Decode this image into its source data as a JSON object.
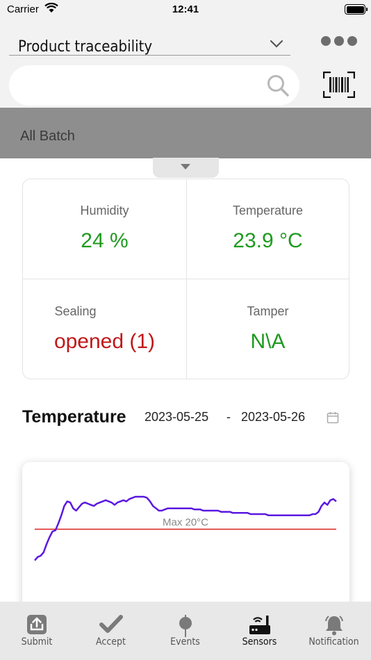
{
  "status_bar": {
    "carrier": "Carrier",
    "time": "12:41"
  },
  "header": {
    "dropdown_label": "Product traceability",
    "search_placeholder": ""
  },
  "filter": {
    "label": "All Batch"
  },
  "sensors": {
    "humidity": {
      "label": "Humidity",
      "value": "24 %"
    },
    "temperature": {
      "label": "Temperature",
      "value": "23.9 °C"
    },
    "sealing": {
      "label": "Sealing",
      "value": "opened (1)"
    },
    "tamper": {
      "label": "Tamper",
      "value": "N\\A"
    }
  },
  "chart_section": {
    "title": "Temperature",
    "date_start": "2023-05-25",
    "date_separator": "-",
    "date_end": "2023-05-26"
  },
  "chart_data": {
    "type": "line",
    "series": [
      {
        "values": [
          17.3,
          17.6,
          17.7,
          18.0,
          18.7,
          19.3,
          19.8,
          19.9,
          20.5,
          21.2,
          22.0,
          22.4,
          22.3,
          21.8,
          21.6,
          21.9,
          22.2,
          22.3,
          22.2,
          22.1,
          22.0,
          22.2,
          22.3,
          22.4,
          22.5,
          22.4,
          22.3,
          22.1,
          22.3,
          22.4,
          22.5,
          22.4,
          22.6,
          22.7,
          22.8,
          22.8,
          22.8,
          22.8,
          22.7,
          22.4,
          22.0,
          21.8,
          21.6,
          21.6,
          21.7,
          21.8,
          21.8,
          21.8,
          21.8,
          21.8,
          21.8,
          21.8,
          21.8,
          21.8,
          21.7,
          21.7,
          21.7,
          21.6,
          21.6,
          21.6,
          21.6,
          21.6,
          21.6,
          21.5,
          21.5,
          21.5,
          21.5,
          21.4,
          21.4,
          21.4,
          21.4,
          21.4,
          21.4,
          21.3,
          21.3,
          21.3,
          21.3,
          21.3,
          21.3,
          21.2,
          21.2,
          21.2,
          21.2,
          21.2,
          21.2,
          21.2,
          21.2,
          21.2,
          21.2,
          21.2,
          21.2,
          21.2,
          21.2,
          21.2,
          21.3,
          21.3,
          21.5,
          22.0,
          22.3,
          22.1,
          22.5,
          22.6,
          22.4
        ]
      }
    ],
    "threshold": {
      "label": "Max 20°C",
      "value": 20,
      "color": "#d8140f"
    },
    "line_color": "#5a18e0",
    "ylim": [
      12,
      24
    ]
  },
  "tabs": [
    {
      "label": "Submit",
      "icon": "upload-icon",
      "active": false
    },
    {
      "label": "Accept",
      "icon": "check-icon",
      "active": false
    },
    {
      "label": "Events",
      "icon": "pin-icon",
      "active": false
    },
    {
      "label": "Sensors",
      "icon": "sensor-router-icon",
      "active": true
    },
    {
      "label": "Notification",
      "icon": "bell-icon",
      "active": false
    }
  ],
  "colors": {
    "ok": "#1e9a1e",
    "alert": "#c01818"
  }
}
